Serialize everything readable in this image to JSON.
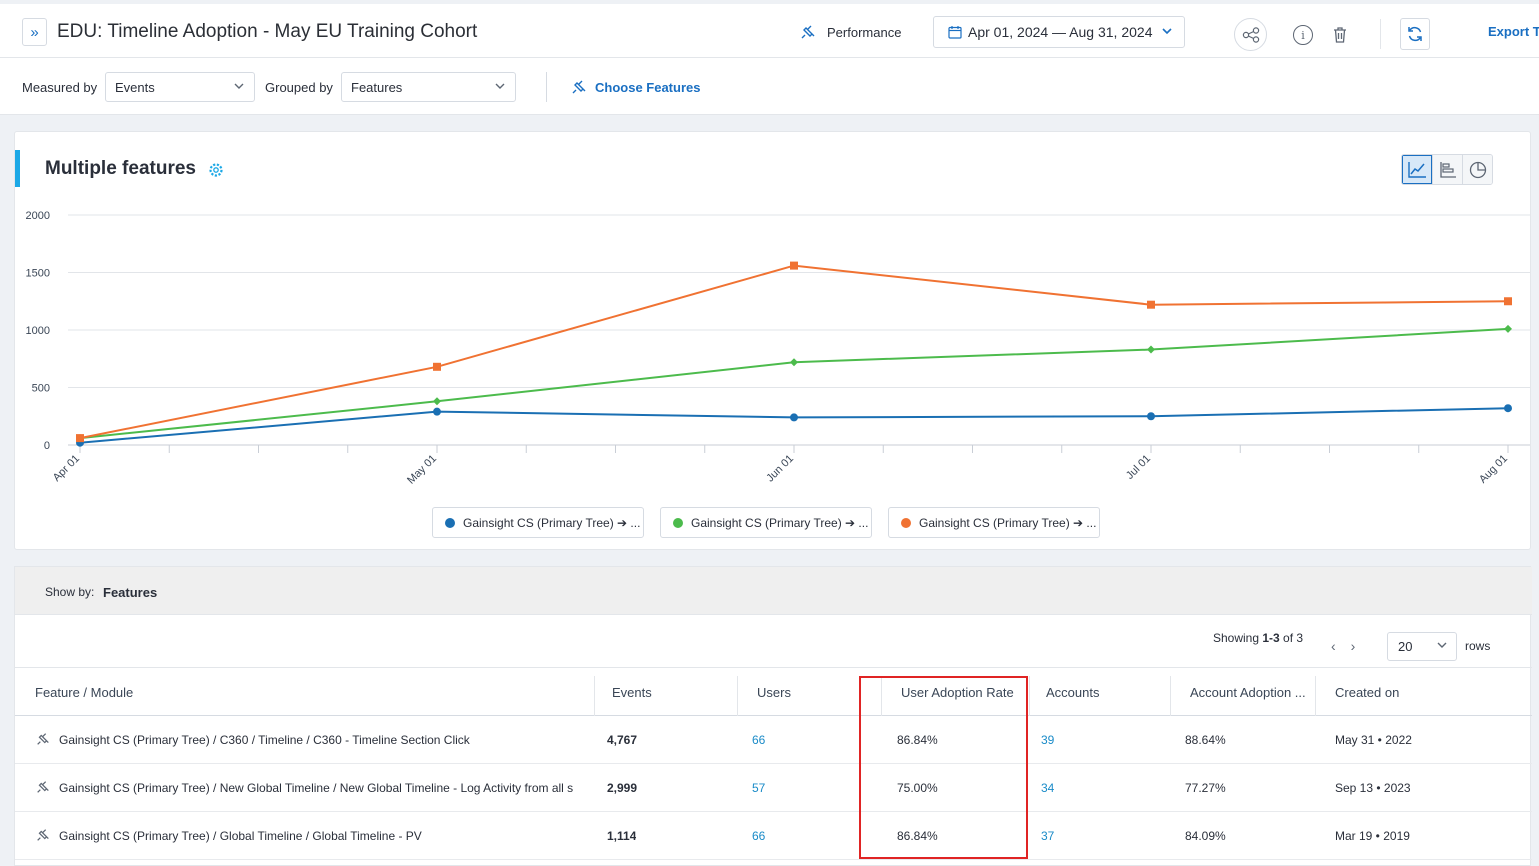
{
  "header": {
    "title": "EDU: Timeline Adoption - May EU Training Cohort",
    "performance_label": "Performance",
    "date_range": "Apr 01, 2024 — Aug 31, 2024",
    "export_label": "Export T"
  },
  "filters": {
    "measured_by_label": "Measured by",
    "measured_by_value": "Events",
    "grouped_by_label": "Grouped by",
    "grouped_by_value": "Features",
    "choose_features_label": "Choose Features"
  },
  "chart_section": {
    "title": "Multiple features"
  },
  "chart_data": {
    "type": "line",
    "title": "Multiple features",
    "x": [
      "Apr 01",
      "May 01",
      "Jun 01",
      "Jul 01",
      "Aug 01"
    ],
    "yticks": [
      "0",
      "500",
      "1000",
      "1500",
      "2000"
    ],
    "ylim": [
      0,
      2000
    ],
    "grid": true,
    "legend_position": "bottom",
    "series": [
      {
        "name": "Gainsight CS (Primary Tree) ➔ ...",
        "color": "#1a6fb3",
        "marker": "circle",
        "values": [
          20,
          290,
          240,
          250,
          320
        ]
      },
      {
        "name": "Gainsight CS (Primary Tree) ➔ ...",
        "color": "#4cbb4c",
        "marker": "diamond",
        "values": [
          60,
          380,
          720,
          830,
          1010
        ]
      },
      {
        "name": "Gainsight CS (Primary Tree) ➔ ...",
        "color": "#f07232",
        "marker": "square",
        "values": [
          60,
          680,
          1560,
          1220,
          1250
        ]
      }
    ]
  },
  "table_section": {
    "showby_label": "Show by:",
    "showby_value": "Features",
    "showing_prefix": "Showing ",
    "showing_range": "1-3",
    "showing_suffix": " of 3",
    "rows_per_page": "20",
    "rows_label": "rows",
    "columns": [
      "Feature / Module",
      "Events",
      "Users",
      "User Adoption Rate",
      "Accounts",
      "Account Adoption ...",
      "Created on"
    ],
    "rows": [
      {
        "feature": "Gainsight CS (Primary Tree) / C360 / Timeline / C360 - Timeline Section Click",
        "events": "4,767",
        "users": "66",
        "user_rate": "86.84%",
        "accounts": "39",
        "account_rate": "88.64%",
        "created": "May 31 • 2022"
      },
      {
        "feature": "Gainsight CS (Primary Tree) / New Global Timeline / New Global Timeline - Log Activity from all s",
        "events": "2,999",
        "users": "57",
        "user_rate": "75.00%",
        "accounts": "34",
        "account_rate": "77.27%",
        "created": "Sep 13 • 2023"
      },
      {
        "feature": "Gainsight CS (Primary Tree) / Global Timeline / Global Timeline - PV",
        "events": "1,114",
        "users": "66",
        "user_rate": "86.84%",
        "accounts": "37",
        "account_rate": "84.09%",
        "created": "Mar 19 • 2019"
      }
    ]
  }
}
